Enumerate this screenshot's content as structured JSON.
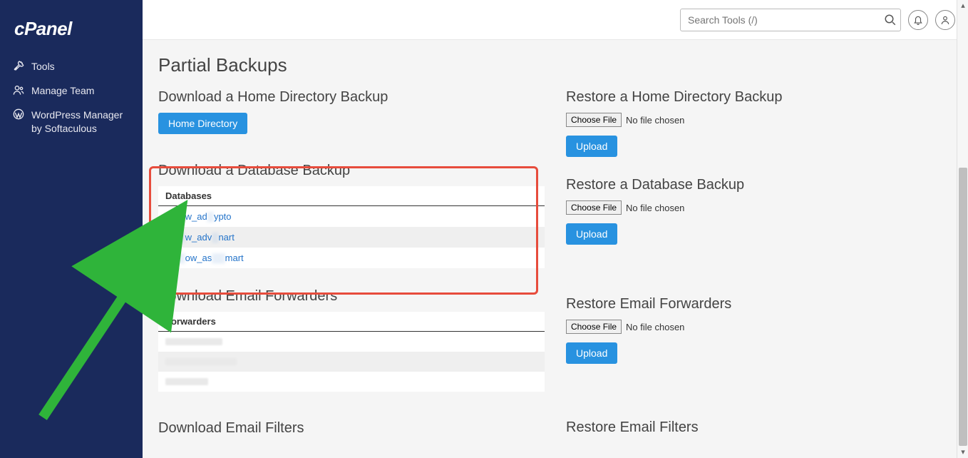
{
  "brand": "cPanel",
  "sidebar": {
    "items": [
      {
        "label": "Tools",
        "icon": "tools"
      },
      {
        "label": "Manage Team",
        "icon": "team"
      },
      {
        "label": "WordPress Manager by Softaculous",
        "icon": "wp"
      }
    ]
  },
  "header": {
    "search_placeholder": "Search Tools (/)"
  },
  "page": {
    "title": "Partial Backups"
  },
  "left": {
    "home_dir": {
      "title": "Download a Home Directory Backup",
      "button": "Home Directory"
    },
    "db": {
      "title": "Download a Database Backup",
      "table_header": "Databases",
      "rows": [
        {
          "pre": "▒▒▒",
          "mid": "w_ad",
          "post": "ypto"
        },
        {
          "pre": "▒▒▒",
          "mid": "w_adv",
          "post": "nart"
        },
        {
          "pre": "▒▒▒",
          "mid": "ow_as",
          "post": "mart"
        }
      ]
    },
    "fwd": {
      "title": "Download Email Forwarders",
      "table_header": "Forwarders"
    },
    "filters": {
      "title": "Download Email Filters"
    }
  },
  "right": {
    "home_dir": {
      "title": "Restore a Home Directory Backup",
      "choose": "Choose File",
      "nofile": "No file chosen",
      "upload": "Upload"
    },
    "db": {
      "title": "Restore a Database Backup",
      "choose": "Choose File",
      "nofile": "No file chosen",
      "upload": "Upload"
    },
    "fwd": {
      "title": "Restore Email Forwarders",
      "choose": "Choose File",
      "nofile": "No file chosen",
      "upload": "Upload"
    },
    "filters": {
      "title": "Restore Email Filters"
    }
  }
}
